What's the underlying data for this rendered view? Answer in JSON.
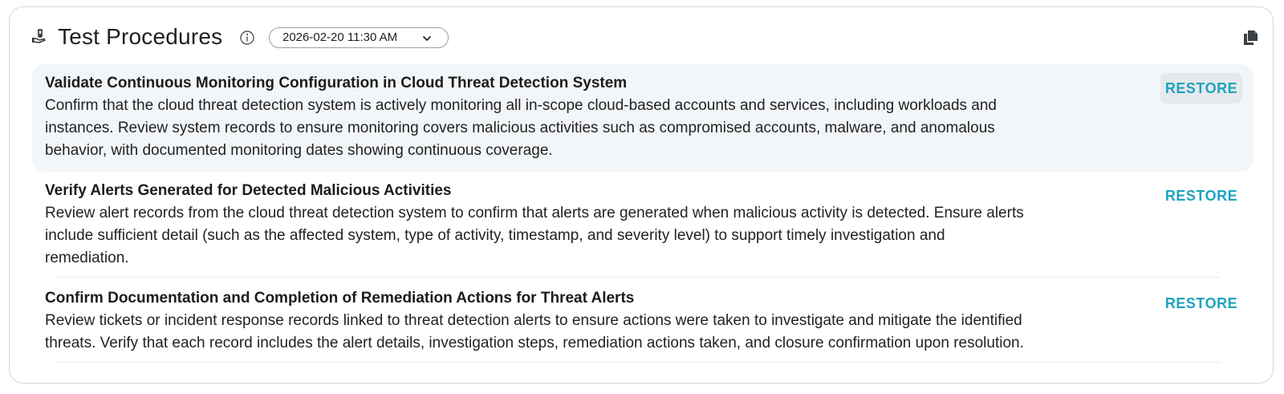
{
  "header": {
    "title": "Test Procedures",
    "title_icon": "test-tube-hand-icon",
    "info_icon": "info-circle-icon",
    "date_selected": "2026-02-20 11:30 AM",
    "copy_icon": "copy-documents-icon"
  },
  "procedures": [
    {
      "title": "Validate Continuous Monitoring Configuration in Cloud Threat Detection System",
      "description_lines": [
        "Confirm that the cloud threat detection system is actively monitoring all in-scope cloud-based accounts and services, including workloads and",
        "instances. Review system records to ensure monitoring covers malicious activities such as compromised accounts, malware, and anomalous",
        "behavior, with documented monitoring dates showing continuous coverage."
      ],
      "action_label": "RESTORE"
    },
    {
      "title": "Verify Alerts Generated for Detected Malicious Activities",
      "description_lines": [
        "Review alert records from the cloud threat detection system to confirm that alerts are generated when malicious activity is detected. Ensure alerts",
        "include sufficient detail (such as the affected system, type of activity, timestamp, and severity level) to support timely investigation and",
        "remediation."
      ],
      "action_label": "RESTORE"
    },
    {
      "title": "Confirm Documentation and Completion of Remediation Actions for Threat Alerts",
      "description_lines": [
        "Review tickets or incident response records linked to threat detection alerts to ensure actions were taken to investigate and mitigate the identified",
        "threats. Verify that each record includes the alert details, investigation steps, remediation actions taken, and closure confirmation upon resolution."
      ],
      "action_label": "RESTORE"
    }
  ],
  "colors": {
    "accent": "#1fa3c0",
    "highlight_bg": "#f3f6f9"
  }
}
